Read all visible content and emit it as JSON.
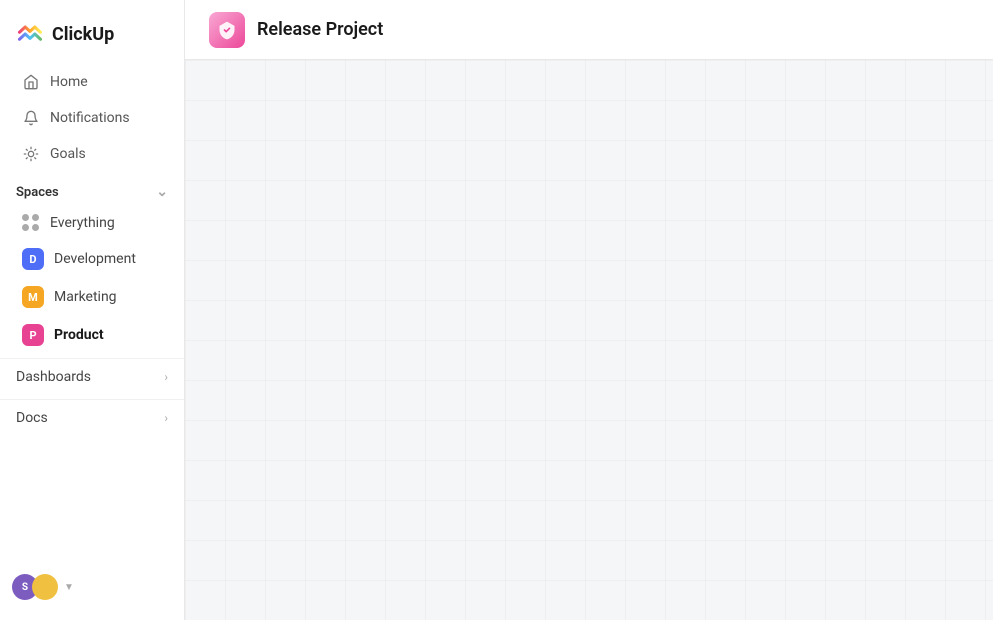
{
  "app": {
    "name": "ClickUp"
  },
  "sidebar": {
    "nav": [
      {
        "id": "home",
        "label": "Home",
        "icon": "home-icon"
      },
      {
        "id": "notifications",
        "label": "Notifications",
        "icon": "bell-icon"
      },
      {
        "id": "goals",
        "label": "Goals",
        "icon": "trophy-icon"
      }
    ],
    "spaces_label": "Spaces",
    "spaces": [
      {
        "id": "everything",
        "label": "Everything",
        "type": "dots"
      },
      {
        "id": "development",
        "label": "Development",
        "type": "badge",
        "badge_letter": "D",
        "badge_color": "blue"
      },
      {
        "id": "marketing",
        "label": "Marketing",
        "type": "badge",
        "badge_letter": "M",
        "badge_color": "yellow"
      },
      {
        "id": "product",
        "label": "Product",
        "type": "badge",
        "badge_letter": "P",
        "badge_color": "pink",
        "active": true
      }
    ],
    "sections": [
      {
        "id": "dashboards",
        "label": "Dashboards"
      },
      {
        "id": "docs",
        "label": "Docs"
      }
    ]
  },
  "main": {
    "project_title": "Release Project",
    "project_icon_alt": "release-project-icon"
  }
}
